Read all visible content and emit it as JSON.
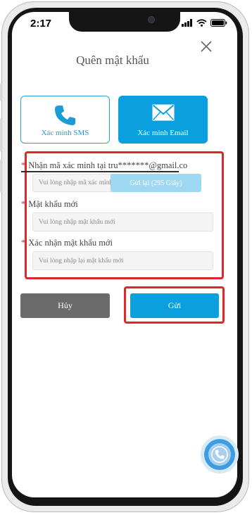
{
  "status_bar": {
    "time": "2:17"
  },
  "dialog": {
    "title": "Quên mật khẩu"
  },
  "methods": [
    {
      "label": "Xác minh SMS",
      "icon": "phone-icon",
      "selected": false
    },
    {
      "label": "Xác minh Email",
      "icon": "mail-icon",
      "selected": true
    }
  ],
  "form": {
    "code_label": "Nhận mã xác minh tại tru*******@gmail.co",
    "code_placeholder": "Vui lòng nhập mã xác minh.",
    "resend_label": "Gửi lại (295 Giây)",
    "new_password_label": "Mật khẩu mới",
    "new_password_placeholder": "Vui lòng nhập mật khẩu mới",
    "confirm_password_label": "Xác nhận mật khẩu mới",
    "confirm_password_placeholder": "Vui lòng nhập lại mật khẩu mới",
    "required_mark": "*"
  },
  "actions": {
    "cancel_label": "Hủy",
    "submit_label": "Gửi"
  },
  "colors": {
    "accent": "#0b9fdd",
    "highlight": "#e0262a",
    "cancel": "#6b6b6b"
  }
}
